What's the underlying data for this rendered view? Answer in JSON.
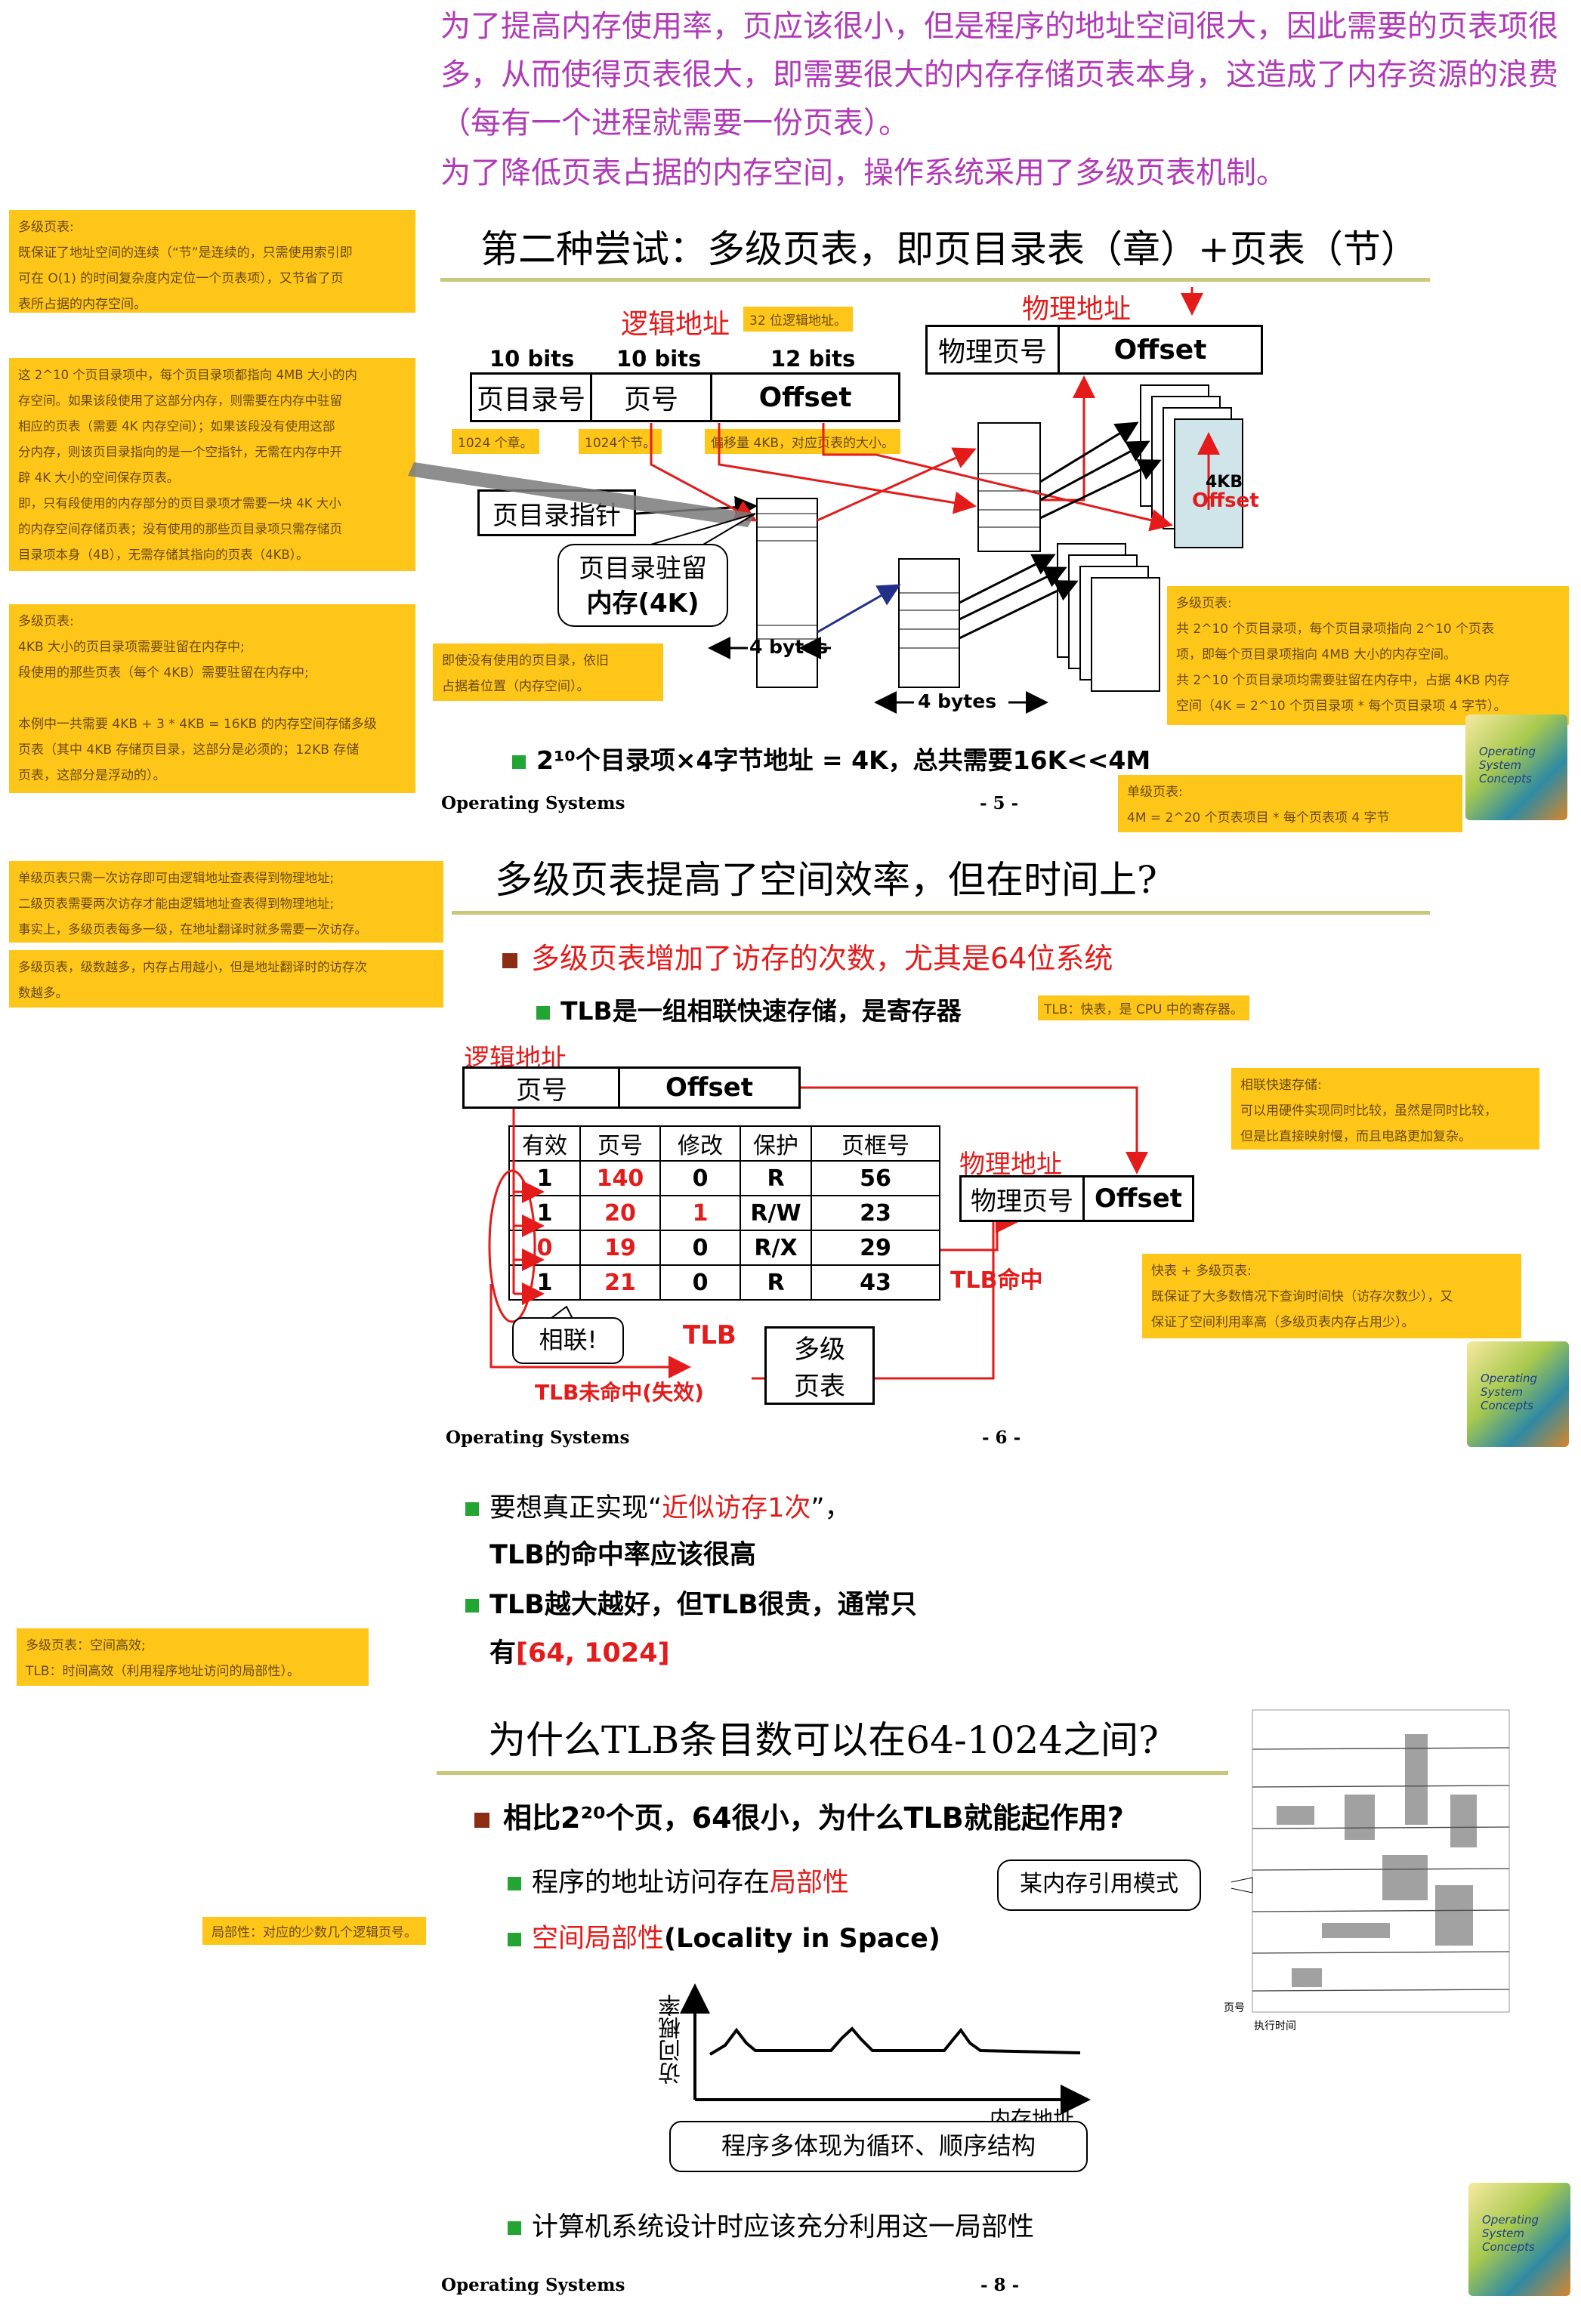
{
  "intro": {
    "p1": "为了提高内存使用率，页应该很小，但是程序的地址空间很大，因此需要的页表项很",
    "p2": "多，从而使得页表很大，即需要很大的内存存储页表本身，这造成了内存资源的浪费",
    "p3": "（每有一个进程就需要一份页表）。",
    "p4": "为了降低页表占据的内存空间，操作系统采用了多级页表机制。"
  },
  "slide5": {
    "title": "第二种尝试：多级页表，即页目录表（章）+页表（节）",
    "logical_label": "逻辑地址",
    "bits10a": "10 bits",
    "bits10b": "10 bits",
    "bits12": "12 bits",
    "field_dir": "页目录号",
    "field_page": "页号",
    "field_offset": "Offset",
    "phys_label": "物理地址",
    "phys_page": "物理页号",
    "phys_offset": "Offset",
    "dir_pointer": "页目录指针",
    "resident_line1": "页目录驻留",
    "resident_line2": "内存(4K)",
    "four_bytes_a": "4 bytes",
    "four_bytes_b": "4 bytes",
    "kb4": "4KB",
    "offset_in_page": "Offset",
    "bottom_line": "2¹⁰个目录项×4字节地址 = 4K，总共需要16K<<4M",
    "footer_left": "Operating Systems",
    "footer_page": "- 5 -"
  },
  "slide6": {
    "title": "多级页表提高了空间效率，但在时间上?",
    "bullet1": "多级页表增加了访存的次数，尤其是64位系统",
    "bullet2": "TLB是一组相联快速存储，是寄存器",
    "logical_label": "逻辑地址",
    "field_page": "页号",
    "field_offset": "Offset",
    "phys_label": "物理地址",
    "phys_page": "物理页号",
    "phys_offset": "Offset",
    "table_headers": [
      "有效",
      "页号",
      "修改",
      "保护",
      "页框号"
    ],
    "table_rows": [
      [
        "1",
        "140",
        "0",
        "R",
        "56"
      ],
      [
        "1",
        "20",
        "1",
        "R/W",
        "23"
      ],
      [
        "0",
        "19",
        "0",
        "R/X",
        "29"
      ],
      [
        "1",
        "21",
        "0",
        "R",
        "43"
      ]
    ],
    "hit_label": "TLB命中",
    "assoc_label": "相联!",
    "tlb_label": "TLB",
    "multi_line1": "多级",
    "multi_line2": "页表",
    "miss_label": "TLB未命中(失效)",
    "footer_left": "Operating Systems",
    "footer_page": "- 6 -"
  },
  "slide7": {
    "b1_prefix": "要想真正实现“",
    "b1_red": "近似访存1次",
    "b1_suffix": "”，",
    "b1_line2": "TLB的命中率应该很高",
    "b2_line1": "TLB越大越好，但TLB很贵，通常只",
    "b2_prefix": "有",
    "b2_red": "[64, 1024]"
  },
  "slide8": {
    "title": "为什么TLB条目数可以在64-1024之间?",
    "bullet1": "相比2²⁰个页，64很小，为什么TLB就能起作用?",
    "sub1_prefix": "程序的地址访问存在",
    "sub1_red": "局部性",
    "sub2_red": "空间局部性",
    "sub2_suffix": "(Locality in Space)",
    "callout_mem": "某内存引用模式",
    "y_axis": "访问概率",
    "x_axis": "内存地址",
    "caption": "程序多体现为循环、顺序结构",
    "bullet3": "计算机系统设计时应该充分利用这一局部性",
    "scatter_ylabel": "页号",
    "scatter_xlabel": "执行时间",
    "footer_left": "Operating Systems",
    "footer_page": "- 8 -"
  },
  "notes": {
    "n1": [
      "多级页表:",
      "既保证了地址空间的连续（“节”是连续的，只需使用索引即",
      "可在 O(1) 的时间复杂度内定位一个页表项），又节省了页",
      "表所占据的内存空间。"
    ],
    "n2": [
      "这 2^10 个页目录项中，每个页目录项都指向 4MB 大小的内",
      "存空间。如果该段使用了这部分内存，则需要在内存中驻留",
      "相应的页表（需要 4K 内存空间）；如果该段没有使用这部",
      "分内存，则该页目录指向的是一个空指针，无需在内存中开",
      "辟 4K 大小的空间保存页表。",
      "即，只有段使用的内存部分的页目录项才需要一块 4K 大小",
      "的内存空间存储页表；没有使用的那些页目录项只需存储页",
      "目录项本身（4B），无需存储其指向的页表（4KB）。"
    ],
    "n3": [
      "多级页表:",
      "4KB 大小的页目录项需要驻留在内存中;",
      "段使用的那些页表（每个 4KB）需要驻留在内存中;",
      "",
      "本例中一共需要 4KB + 3 * 4KB = 16KB 的内存空间存储多级",
      "页表（其中 4KB 存储页目录，这部分是必须的；12KB 存储",
      "页表，这部分是浮动的）。"
    ],
    "n_32bit": "32 位逻辑地址。",
    "n_1024ch": "1024 个章。",
    "n_1024jie": "1024个节。",
    "n_offset": "偏移量 4KB，对应页表的大小。",
    "n_unused": [
      "即使没有使用的页目录，依旧",
      "占据着位置（内存空间）。"
    ],
    "n_right5": [
      "多级页表:",
      "共 2^10 个页目录项，每个页目录项指向 2^10 个页表",
      "项，即每个页目录项指向 4MB 大小的内存空间。",
      "共 2^10 个页目录项均需要驻留在内存中，占据 4KB 内存",
      "空间（4K = 2^10 个页目录项 * 每个页目录项 4 字节）。"
    ],
    "n_single": [
      "单级页表:",
      "4M = 2^20 个页表项目 * 每个页表项 4 字节"
    ],
    "n_left6a": [
      "单级页表只需一次访存即可由逻辑地址查表得到物理地址;",
      "二级页表需要两次访存才能由逻辑地址查表得到物理地址;",
      "事实上，多级页表每多一级，在地址翻译时就多需要一次访存。"
    ],
    "n_left6b": [
      "多级页表，级数越多，内存占用越小，但是地址翻译时的访存次",
      "数越多。"
    ],
    "n_tlb": "TLB：快表，是 CPU 中的寄存器。",
    "n_assoc": [
      "相联快速存储:",
      "可以用硬件实现同时比较，虽然是同时比较，",
      "但是比直接映射慢，而且电路更加复杂。"
    ],
    "n_fast": [
      "快表 + 多级页表:",
      "既保证了大多数情况下查询时间快（访存次数少），又",
      "保证了空间利用率高（多级页表内存占用少）。"
    ],
    "n_left7": [
      "多级页表：空间高效;",
      "TLB：时间高效（利用程序地址访问的局部性）。"
    ],
    "n_local": "局部性：对应的少数几个逻辑页号。"
  },
  "book": {
    "text": "Operating System Concepts"
  }
}
